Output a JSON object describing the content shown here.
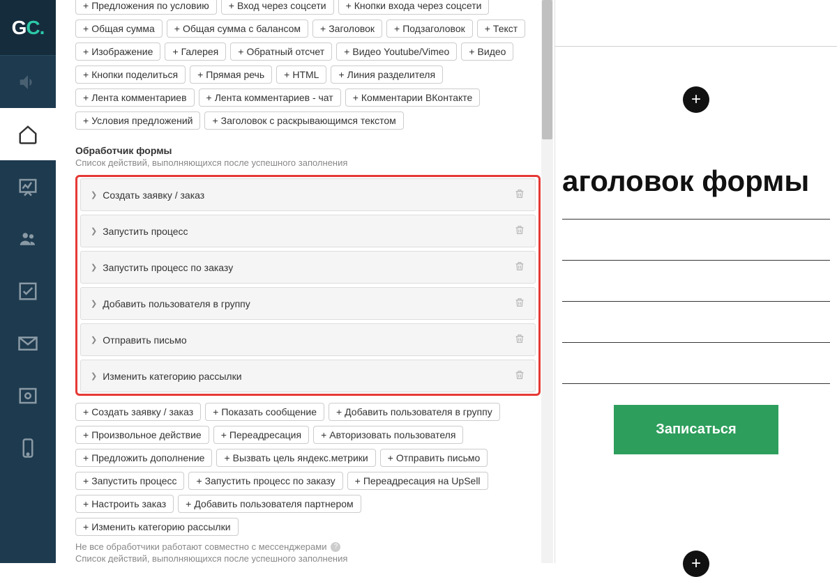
{
  "logo": {
    "g": "G",
    "c": "C",
    "dot": "."
  },
  "tag_groups": [
    [
      "Предложения по условию",
      "Вход через соцсети",
      "Кнопки входа через соцсети"
    ],
    [
      "Общая сумма",
      "Общая сумма с балансом",
      "Заголовок",
      "Подзаголовок",
      "Текст"
    ],
    [
      "Изображение",
      "Галерея",
      "Обратный отсчет",
      "Видео Youtube/Vimeo",
      "Видео"
    ],
    [
      "Кнопки поделиться",
      "Прямая речь",
      "HTML",
      "Линия разделителя"
    ],
    [
      "Лента комментариев",
      "Лента комментариев - чат",
      "Комментарии ВКонтакте"
    ],
    [
      "Условия предложений",
      "Заголовок с раскрывающимся текстом"
    ]
  ],
  "handler_section": {
    "title": "Обработчик формы",
    "sub": "Список действий, выполняющихся после успешного заполнения"
  },
  "handlers": [
    "Создать заявку / заказ",
    "Запустить процесс",
    "Запустить процесс по заказу",
    "Добавить пользователя в группу",
    "Отправить письмо",
    "Изменить категорию рассылки"
  ],
  "handler_add_groups": [
    [
      "Создать заявку / заказ",
      "Показать сообщение",
      "Добавить пользователя в группу"
    ],
    [
      "Произвольное действие",
      "Переадресация",
      "Авторизовать пользователя"
    ],
    [
      "Предложить дополнение",
      "Вызвать цель яндекс.метрики",
      "Отправить письмо"
    ],
    [
      "Запустить процесс",
      "Запустить процесс по заказу",
      "Переадресация на UpSell"
    ],
    [
      "Настроить заказ",
      "Добавить пользователя партнером"
    ],
    [
      "Изменить категорию рассылки"
    ]
  ],
  "notes": {
    "n1": "Не все обработчики работают совместно с мессенджерами",
    "n2": "Список действий, выполняющихся после успешного заполнения"
  },
  "preview": {
    "title": "аголовок формы",
    "button": "Записаться"
  }
}
